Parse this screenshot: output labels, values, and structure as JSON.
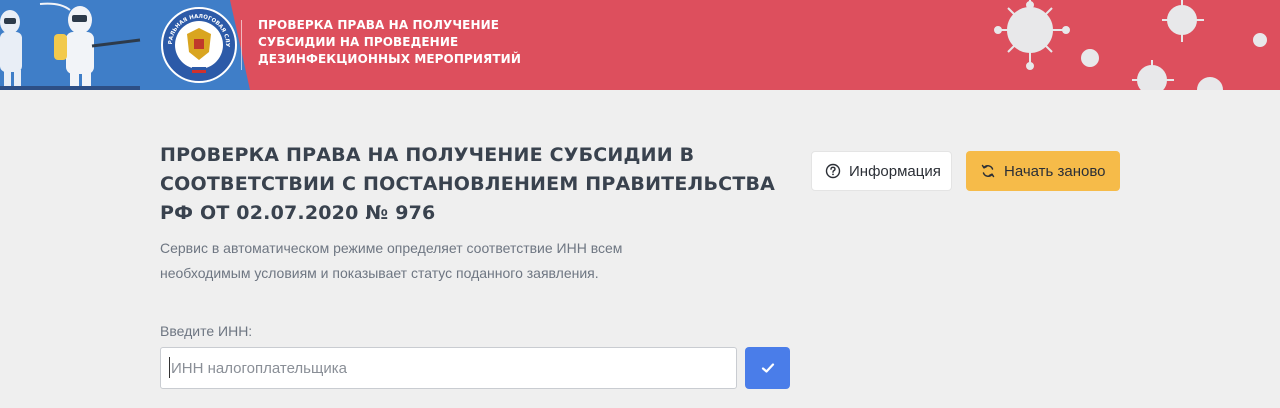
{
  "banner": {
    "title_lines": [
      "ПРОВЕРКА ПРАВА НА ПОЛУЧЕНИЕ",
      "СУБСИДИИ НА ПРОВЕДЕНИЕ",
      "ДЕЗИНФЕКЦИОННЫХ МЕРОПРИЯТИЙ"
    ],
    "emblem_text": "ФЕДЕРАЛЬНАЯ НАЛОГОВАЯ СЛУЖБА",
    "colors": {
      "background": "#dd4f5d",
      "left_panel": "#3f7ec8"
    }
  },
  "main": {
    "title_lines": [
      "ПРОВЕРКА ПРАВА НА ПОЛУЧЕНИЕ СУБСИДИИ В",
      "СООТВЕТСТВИИ С ПОСТАНОВЛЕНИЕМ ПРАВИТЕЛЬСТВА",
      "РФ ОТ 02.07.2020 № 976"
    ],
    "description_lines": [
      "Сервис в автоматическом режиме определяет соответствие ИНН всем",
      "необходимым условиям и показывает статус поданного заявления."
    ]
  },
  "actions": {
    "info_label": "Информация",
    "info_icon": "question-circle-icon",
    "restart_label": "Начать заново",
    "restart_icon": "refresh-icon",
    "restart_color": "#f6bb49"
  },
  "form": {
    "inn_label": "Введите ИНН:",
    "inn_placeholder": "ИНН налогоплательщика",
    "inn_value": "",
    "submit_icon": "checkmark-icon",
    "submit_color": "#4a7de9"
  }
}
